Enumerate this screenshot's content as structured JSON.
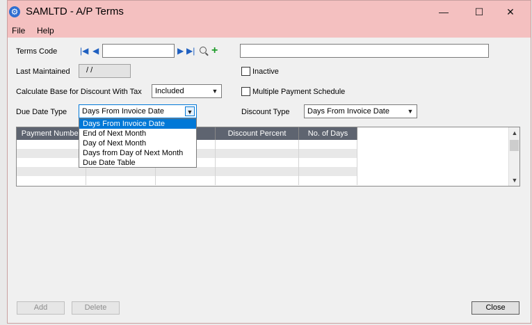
{
  "window": {
    "title": "SAMLTD - A/P Terms",
    "minimize_glyph": "—",
    "maximize_glyph": "☐",
    "close_glyph": "✕"
  },
  "menu": [
    "File",
    "Help"
  ],
  "form": {
    "terms_code_label": "Terms Code",
    "terms_code_value": "",
    "description_value": "",
    "last_maintained_label": "Last Maintained",
    "last_maintained_value": "/ /",
    "inactive_label": "Inactive",
    "inactive_checked": false,
    "calc_base_label": "Calculate Base for Discount With Tax",
    "calc_base_value": "Included",
    "multiple_payment_label": "Multiple Payment Schedule",
    "multiple_payment_checked": false,
    "due_date_type_label": "Due Date Type",
    "due_date_type_value": "Days From Invoice Date",
    "discount_type_label": "Discount Type",
    "discount_type_value": "Days From Invoice Date"
  },
  "due_date_options": [
    "Days From Invoice Date",
    "End of Next Month",
    "Day of Next Month",
    "Days from Day of Next Month",
    "Due Date Table"
  ],
  "grid": {
    "columns": [
      "Payment Number",
      "",
      "Days",
      "Discount Percent",
      "No. of Days"
    ]
  },
  "buttons": {
    "add": "Add",
    "delete": "Delete",
    "close": "Close"
  },
  "colors": {
    "titlebar": "#f4c0c0",
    "selection": "#0078d7",
    "grid_header": "#5e6470"
  }
}
